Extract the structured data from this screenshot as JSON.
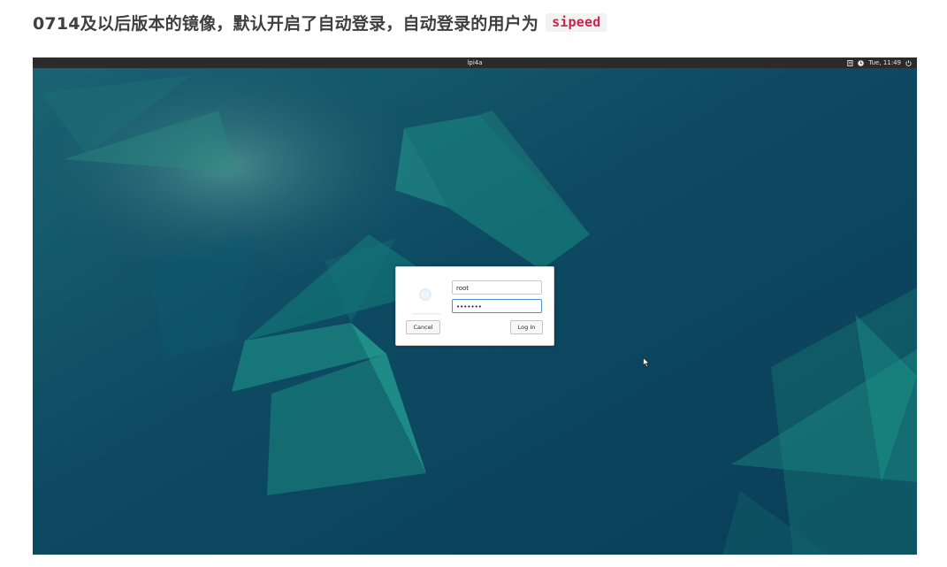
{
  "doc": {
    "heading_text": "0714及以后版本的镜像，默认开启了自动登录，自动登录的用户为",
    "heading_code": "sipeed"
  },
  "topbar": {
    "hostname": "lpi4a",
    "clock": "Tue, 11:49",
    "icons": [
      "notes-icon",
      "clock-icon",
      "power-icon"
    ]
  },
  "login_dialog": {
    "username_value": "root",
    "password_value": "•••••••",
    "cancel_label": "Cancel",
    "login_label": "Log In"
  },
  "colors": {
    "wallpaper_base": "#0c4360",
    "accent": "#4a90d9",
    "code_text": "#c7254e"
  }
}
